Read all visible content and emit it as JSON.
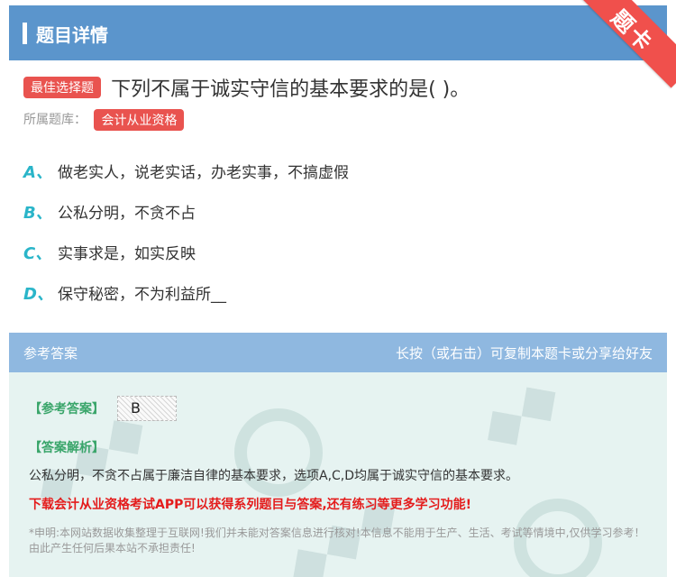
{
  "header": {
    "title": "题目详情"
  },
  "ribbon": {
    "label": "题卡"
  },
  "question": {
    "type_badge": "最佳选择题",
    "text": "下列不属于诚实守信的基本要求的是( )。",
    "source_label": "所属题库：",
    "source_value": "会计从业资格"
  },
  "options": [
    {
      "letter": "A、",
      "text": "做老实人，说老实话，办老实事，不搞虚假"
    },
    {
      "letter": "B、",
      "text": "公私分明，不贪不占"
    },
    {
      "letter": "C、",
      "text": "实事求是，如实反映"
    },
    {
      "letter": "D、",
      "text": "保守秘密，不为利益所__"
    }
  ],
  "answer_section": {
    "title": "参考答案",
    "hint": "长按（或右击）可复制本题卡或分享给好友",
    "ref_label": "【参考答案】",
    "ref_value": "B",
    "exp_label": "【答案解析】",
    "explanation": "公私分明，不贪不占属于廉洁自律的基本要求，选项A,C,D均属于诚实守信的基本要求。",
    "promo": "下载会计从业资格考试APP可以获得系列题目与答案,还有练习等更多学习功能!",
    "disclaimer": "*申明:本网站数据收集整理于互联网!我们并未能对答案信息进行核对!本信息不能用于生产、生活、考试等情境中,仅供学习参考！由此产生任何后果本站不承担责任!"
  },
  "colors": {
    "header": "#5b95cc",
    "badge": "#e9534f",
    "option_letter": "#2ab5c9",
    "answer_head": "#8fb8e0",
    "answer_bg": "#e6f3f1",
    "label_green": "#39a56a",
    "promo_red": "#e41c1c"
  }
}
